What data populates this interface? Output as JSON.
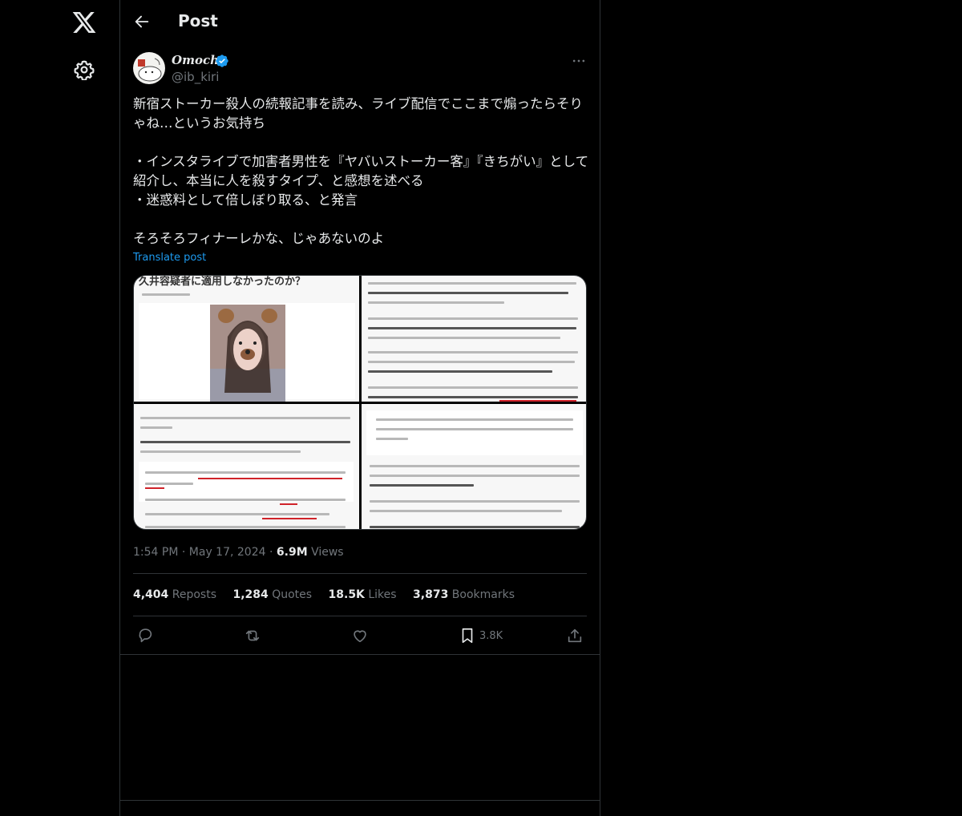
{
  "nav": {
    "logo_icon": "x-logo-icon",
    "settings_icon": "gear-icon"
  },
  "header": {
    "title": "Post",
    "back_icon": "arrow-left-icon"
  },
  "tweet": {
    "author_name": "Omochi",
    "author_handle": "@ib_kiri",
    "text_lines": [
      "新宿ストーカー殺人の続報記事を読み、ライブ配信でここまで煽ったらそりゃね…というお気持ち",
      "",
      "・インスタライブで加害者男性を『ヤバいストーカー客』『きちがい』として紹介し、本当に人を殺すタイプ、と感想を述べる\n・迷惑料として倍しぼり取る、と発言",
      "",
      "そろそろフィナーレかな、じゃあないのよ"
    ],
    "translate_label": "Translate post",
    "media_headline": "久井容疑者に適用しなかったのか？",
    "time": "1:54 PM",
    "date": "May 17, 2024",
    "views_count": "6.9M",
    "views_label": "Views",
    "stats": {
      "reposts_count": "4,404",
      "reposts_label": "Reposts",
      "quotes_count": "1,284",
      "quotes_label": "Quotes",
      "likes_count": "18.5K",
      "likes_label": "Likes",
      "bookmarks_count": "3,873",
      "bookmarks_label": "Bookmarks"
    },
    "bookmark_action_count": "3.8K"
  },
  "colors": {
    "accent": "#1d9bf0",
    "background": "#000000",
    "border": "#2f3336",
    "muted": "#71767b",
    "text": "#e7e9ea"
  }
}
